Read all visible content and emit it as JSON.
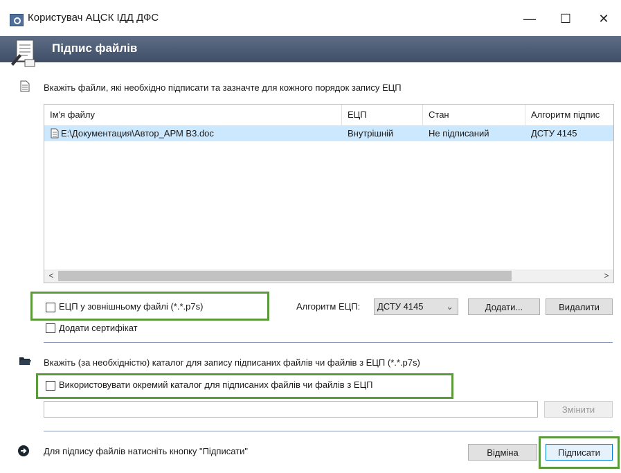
{
  "window": {
    "title": "Користувач АЦСК ІДД ДФС",
    "minimize": "—",
    "maximize": "☐",
    "close": "✕"
  },
  "header": {
    "title": "Підпис файлів"
  },
  "files_section": {
    "instruction": "Вкажіть файли, які необхідно підписати та зазначте для кожного порядок запису ЕЦП"
  },
  "table": {
    "columns": [
      "Ім'я файлу",
      "ЕЦП",
      "Стан",
      "Алгоритм підпис"
    ],
    "rows": [
      {
        "file": "E:\\Документация\\Автор_АРМ В3.doc",
        "sign": "Внутрішній",
        "status": "Не підписаний",
        "algorithm": "ДСТУ 4145"
      }
    ],
    "scroll_left": "<",
    "scroll_right": ">"
  },
  "options": {
    "external_sig_label": "ЕЦП у зовнішньому файлі (*.*.p7s)",
    "add_cert_label": "Додати сертифікат",
    "algorithm_label": "Алгоритм ЕЦП:",
    "algorithm_value": "ДСТУ 4145",
    "add_button": "Додати...",
    "delete_button": "Видалити"
  },
  "folder_section": {
    "instruction": "Вкажіть (за необхідністю) каталог для запису підписаних файлів чи файлів з ЕЦП (*.*.p7s)",
    "separate_folder_label": "Використовувати окремий каталог для підписаних файлів чи файлів з ЕЦП",
    "path_value": "",
    "change_button": "Змінити"
  },
  "footer": {
    "hint": "Для підпису файлів натисніть кнопку \"Підписати\"",
    "cancel_button": "Відміна",
    "sign_button": "Підписати"
  },
  "colors": {
    "header_bg": "#4b5a73",
    "highlight_green": "#5a9a3a",
    "row_selected": "#cce8ff"
  }
}
